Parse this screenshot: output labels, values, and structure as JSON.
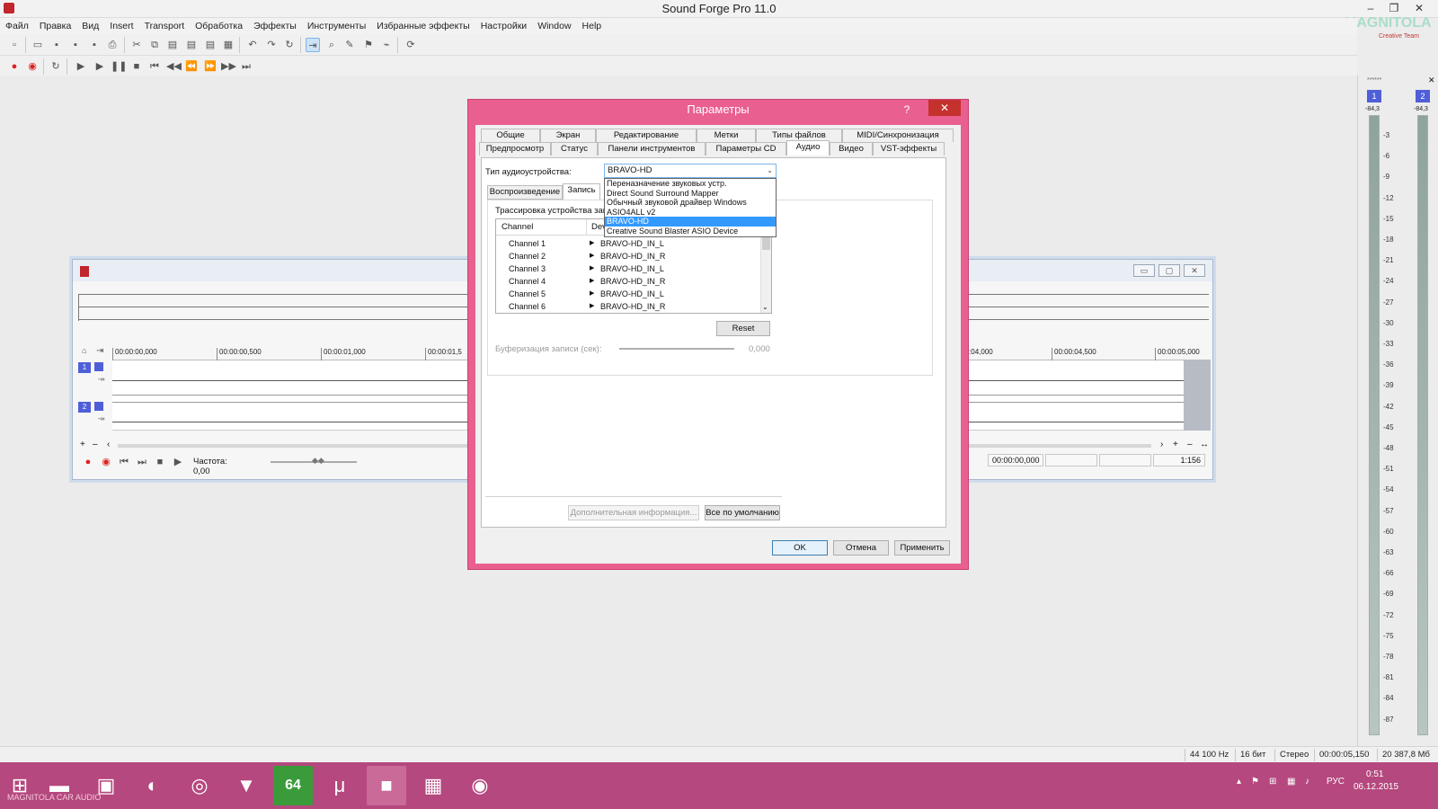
{
  "app": {
    "title": "Sound Forge Pro 11.0",
    "min": "–",
    "restore": "❐",
    "close": "✕",
    "logo": "MAGNITOLA",
    "logo_sub": "Creative Team"
  },
  "menu": [
    "Файл",
    "Правка",
    "Вид",
    "Insert",
    "Transport",
    "Обработка",
    "Эффекты",
    "Инструменты",
    "Избранные эффекты",
    "Настройки",
    "Window",
    "Help"
  ],
  "datawin": {
    "ruler": [
      "00:00:00,000",
      "00:00:00,500",
      "00:00:01,000",
      "00:00:01,5",
      "00:00:04,000",
      "00:00:04,500",
      "00:00:05,000"
    ],
    "ch1": "1",
    "ch2": "2",
    "minus_inf": "-∞",
    "freq_label": "Частота: 0,00",
    "pos": "00:00:00,000",
    "zoom": "1:156"
  },
  "meters": {
    "ch1": "1",
    "ch2": "2",
    "val1": "-84,3",
    "val2": "-84,3",
    "scale": [
      "-3",
      "-6",
      "-9",
      "-12",
      "-15",
      "-18",
      "-21",
      "-24",
      "-27",
      "-30",
      "-33",
      "-36",
      "-39",
      "-42",
      "-45",
      "-48",
      "-51",
      "-54",
      "-57",
      "-60",
      "-63",
      "-66",
      "-69",
      "-72",
      "-75",
      "-78",
      "-81",
      "-84",
      "-87"
    ],
    "top_label": "******"
  },
  "statusbar": {
    "rate": "44 100 Hz",
    "bits": "16 бит",
    "mode": "Стерео",
    "length": "00:00:05,150",
    "size": "20 387,8 Мб"
  },
  "taskbar": {
    "lang": "РУС",
    "time": "0:51",
    "date": "06.12.2015",
    "watermark": "MAGNITOLA CAR AUDIO"
  },
  "dialog": {
    "title": "Параметры",
    "help": "?",
    "close": "✕",
    "tabs_row1": [
      "Общие",
      "Экран",
      "Редактирование",
      "Метки",
      "Типы файлов",
      "MIDI/Синхронизация"
    ],
    "tabs_row2": [
      "Предпросмотр",
      "Статус",
      "Панели инструментов",
      "Параметры CD",
      "Аудио",
      "Видео",
      "VST-эффекты"
    ],
    "device_type_label": "Тип аудиоустройства:",
    "device_type_value": "BRAVO-HD",
    "device_options": [
      "Переназначение звуковых устр.",
      "Direct Sound Surround Mapper",
      "Обычный звуковой драйвер Windows",
      "ASIO4ALL v2",
      "BRAVO-HD",
      "Creative Sound Blaster ASIO Device"
    ],
    "subtab_playback": "Воспроизведение",
    "subtab_record": "Запись",
    "routing_label": "Трассировка устройства записи:",
    "col_channel": "Channel",
    "col_device": "Device",
    "rows": [
      {
        "ch": "Channel 1",
        "dev": "BRAVO-HD_IN_L"
      },
      {
        "ch": "Channel 2",
        "dev": "BRAVO-HD_IN_R"
      },
      {
        "ch": "Channel 3",
        "dev": "BRAVO-HD_IN_L"
      },
      {
        "ch": "Channel 4",
        "dev": "BRAVO-HD_IN_R"
      },
      {
        "ch": "Channel 5",
        "dev": "BRAVO-HD_IN_L"
      },
      {
        "ch": "Channel 6",
        "dev": "BRAVO-HD_IN_R"
      }
    ],
    "reset": "Reset",
    "buffer_label": "Буферизация записи (сек):",
    "buffer_value": "0,000",
    "more_info": "Дополнительная информация...",
    "all_default": "Все по умолчанию",
    "ok": "OK",
    "cancel": "Отмена",
    "apply": "Применить"
  }
}
